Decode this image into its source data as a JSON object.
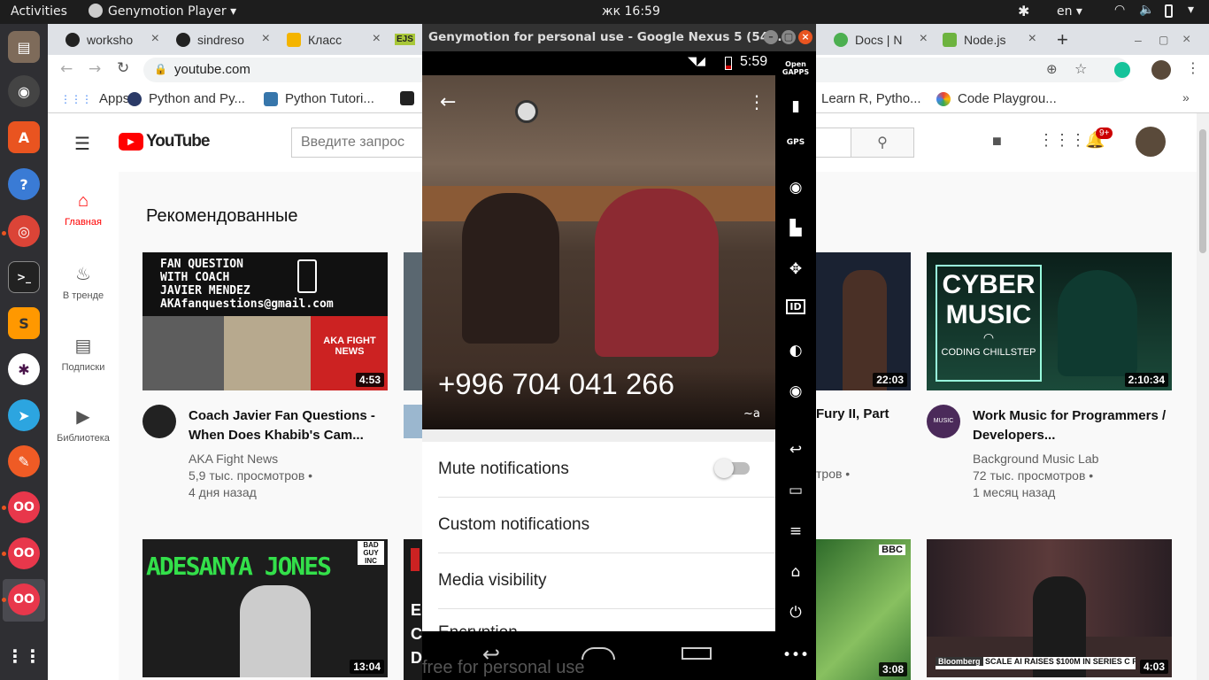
{
  "topbar": {
    "activities": "Activities",
    "app_menu": "Genymotion Player ▾",
    "clock": "жк 16:59",
    "lang": "en ▾"
  },
  "chrome": {
    "tabs": [
      {
        "label": "worksho"
      },
      {
        "label": "sindreso"
      },
      {
        "label": "Класс"
      },
      {
        "label": "EJS"
      },
      {
        "label": "Docs | N"
      },
      {
        "label": "Node.js"
      }
    ],
    "url": "youtube.com",
    "bookmarks": [
      {
        "label": "Apps"
      },
      {
        "label": "Python and Py..."
      },
      {
        "label": "Python Tutori..."
      },
      {
        "label": "Learn R, Pytho..."
      },
      {
        "label": "Code Playgrou..."
      }
    ]
  },
  "youtube": {
    "logo": "YouTube",
    "search_placeholder": "Введите запрос",
    "notif_badge": "9+",
    "section_title": "Рекомендованные",
    "sidebar": [
      {
        "label": "Главная"
      },
      {
        "label": "В тренде"
      },
      {
        "label": "Подписки"
      },
      {
        "label": "Библиотека"
      }
    ],
    "videos": [
      {
        "title": "Coach Javier Fan Questions - When Does Khabib's Cam...",
        "channel": "AKA Fight News",
        "views": "5,9 тыс. просмотров •",
        "age": "4 дня назад",
        "duration": "4:53",
        "thumb_lines": [
          "FAN QUESTION",
          "WITH COACH",
          "JAVIER MENDEZ",
          "AKAfanquestions@gmail.com"
        ],
        "thumb_logo": "AKA FIGHT NEWS"
      },
      {
        "title_fragment": "Fury II, Part",
        "views_fragment": "тров •",
        "duration": "22:03"
      },
      {
        "title": "Work Music for Programmers / Developers...",
        "channel": "Background Music Lab",
        "views": "72 тыс. просмотров •",
        "age": "1 месяц назад",
        "duration": "2:10:34",
        "thumb_lines": [
          "CYBER",
          "MUSIC",
          "CODING CHILLSTEP"
        ],
        "avatar_text": "MUSIC"
      },
      {
        "duration": "13:04",
        "thumb_text": "ADESANYA JONES",
        "badge": "BAD GUY INC"
      },
      {
        "duration": "3:08",
        "thumb_text": "BBC"
      },
      {
        "duration": "4:03",
        "ticker_brand": "Bloomberg",
        "ticker_text": "SCALE AI RAISES $100M IN SERIES C FUND"
      }
    ],
    "partial_letters": [
      "E",
      "C",
      "D"
    ]
  },
  "genymotion": {
    "title": "Genymotion for personal use - Google Nexus 5 (54...",
    "time": "5:59",
    "phone_number": "+996 704 041 266",
    "contact_tag": "~a",
    "settings": [
      {
        "label": "Mute notifications"
      },
      {
        "label": "Custom notifications"
      },
      {
        "label": "Media visibility"
      },
      {
        "label": "Encryption"
      }
    ],
    "watermark": "free for personal use",
    "rail_top": "Open GAPPS",
    "rail_gps": "GPS",
    "rail_id": "ID"
  }
}
